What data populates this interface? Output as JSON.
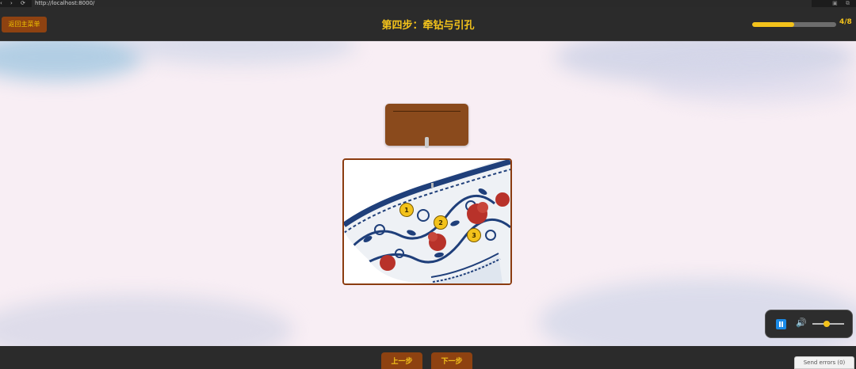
{
  "browser": {
    "url": "http://localhost:8000/",
    "nav_glyphs": "‹ › ⟳",
    "ext_glyphs": "▣ ⧉"
  },
  "header": {
    "back_label": "返回主菜单",
    "title": "第四步：牵钻与引孔",
    "progress": {
      "current": 4,
      "total": 8,
      "text": "4/8"
    }
  },
  "main": {
    "markers": [
      "1",
      "2",
      "3"
    ]
  },
  "audio": {
    "state": "playing",
    "volume_icon": "🔊",
    "volume_level": 0.45
  },
  "footer": {
    "prev_label": "上一步",
    "next_label": "下一步",
    "send_errors_label": "Send errors (0)"
  },
  "colors": {
    "accent_yellow": "#f3c21b",
    "button_brown": "#8e4211",
    "bar_dark": "#2b2b2b",
    "bowl_blue": "#1f3f7a",
    "bowl_red": "#b8322a"
  }
}
